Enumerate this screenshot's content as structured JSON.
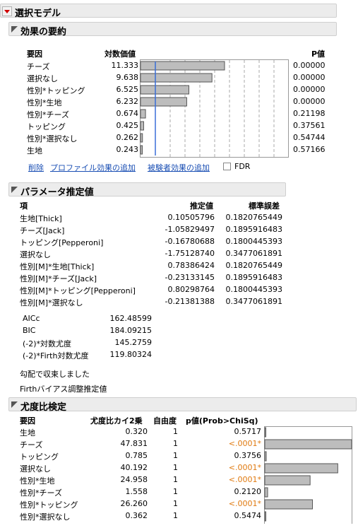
{
  "main_title": "選択モデル",
  "effects": {
    "title": "効果の要約",
    "col_source": "要因",
    "col_logworth": "対数価値",
    "col_p": "P値",
    "rows": [
      {
        "source": "チーズ",
        "logworth": "11.333",
        "value": 11.333,
        "p": "0.00000"
      },
      {
        "source": "選択なし",
        "logworth": "9.638",
        "value": 9.638,
        "p": "0.00000"
      },
      {
        "source": "性別*トッピング",
        "logworth": "6.525",
        "value": 6.525,
        "p": "0.00000"
      },
      {
        "source": "性別*生地",
        "logworth": "6.232",
        "value": 6.232,
        "p": "0.00000"
      },
      {
        "source": "性別*チーズ",
        "logworth": "0.674",
        "value": 0.674,
        "p": "0.21198"
      },
      {
        "source": "トッピング",
        "logworth": "0.425",
        "value": 0.425,
        "p": "0.37561"
      },
      {
        "source": "性別*選択なし",
        "logworth": "0.262",
        "value": 0.262,
        "p": "0.54744"
      },
      {
        "source": "生地",
        "logworth": "0.243",
        "value": 0.243,
        "p": "0.57166"
      }
    ],
    "bar_max": 20,
    "ref_line_value": 2,
    "actions": {
      "remove": "削除",
      "add_profile": "プロファイル効果の追加",
      "add_subject": "被験者効果の追加",
      "fdr": "FDR"
    }
  },
  "params": {
    "title": "パラメータ推定値",
    "col_term": "項",
    "col_estimate": "推定値",
    "col_se": "標準誤差",
    "rows": [
      {
        "term": "生地[Thick]",
        "estimate": "0.10505796",
        "se": "0.1820765449"
      },
      {
        "term": "チーズ[Jack]",
        "estimate": "-1.05829497",
        "se": "0.1895916483"
      },
      {
        "term": "トッピング[Pepperoni]",
        "estimate": "-0.16780688",
        "se": "0.1800445393"
      },
      {
        "term": "選択なし",
        "estimate": "-1.75128740",
        "se": "0.3477061891"
      },
      {
        "term": "性別[M]*生地[Thick]",
        "estimate": "0.78386424",
        "se": "0.1820765449"
      },
      {
        "term": "性別[M]*チーズ[Jack]",
        "estimate": "-0.23133145",
        "se": "0.1895916483"
      },
      {
        "term": "性別[M]*トッピング[Pepperoni]",
        "estimate": "0.80298764",
        "se": "0.1800445393"
      },
      {
        "term": "性別[M]*選択なし",
        "estimate": "-0.21381388",
        "se": "0.3477061891"
      }
    ],
    "stats": [
      {
        "label": "AICc",
        "value": "162.48599"
      },
      {
        "label": "BIC",
        "value": "184.09215"
      },
      {
        "label": "(-2)*対数尤度",
        "value": "145.2759"
      },
      {
        "label": "(-2)*Firth対数尤度",
        "value": "119.80324"
      }
    ],
    "note1": "勾配で収束しました",
    "note2": "Firthバイアス調整推定値"
  },
  "lr": {
    "title": "尤度比検定",
    "col_source": "要因",
    "col_chisq": "尤度比カイ2乗",
    "col_df": "自由度",
    "col_p": "p値(Prob>ChiSq)",
    "rows": [
      {
        "source": "生地",
        "chisq": "0.320",
        "df": "1",
        "p": "0.5717",
        "sig": false,
        "value": 0.32
      },
      {
        "source": "チーズ",
        "chisq": "47.831",
        "df": "1",
        "p": "<.0001*",
        "sig": true,
        "value": 47.831
      },
      {
        "source": "トッピング",
        "chisq": "0.785",
        "df": "1",
        "p": "0.3756",
        "sig": false,
        "value": 0.785
      },
      {
        "source": "選択なし",
        "chisq": "40.192",
        "df": "1",
        "p": "<.0001*",
        "sig": true,
        "value": 40.192
      },
      {
        "source": "性別*生地",
        "chisq": "24.958",
        "df": "1",
        "p": "<.0001*",
        "sig": true,
        "value": 24.958
      },
      {
        "source": "性別*チーズ",
        "chisq": "1.558",
        "df": "1",
        "p": "0.2120",
        "sig": false,
        "value": 1.558
      },
      {
        "source": "性別*トッピング",
        "chisq": "26.260",
        "df": "1",
        "p": "<.0001*",
        "sig": true,
        "value": 26.26
      },
      {
        "source": "性別*選択なし",
        "chisq": "0.362",
        "df": "1",
        "p": "0.5474",
        "sig": false,
        "value": 0.362
      }
    ],
    "bar_max": 47.831
  },
  "colors": {
    "bar_fill": "#bdbdbd",
    "bar_stroke": "#555555",
    "ref_line": "#3a6fd8",
    "sig": "#e07a10",
    "accent_red": "#d00000"
  }
}
